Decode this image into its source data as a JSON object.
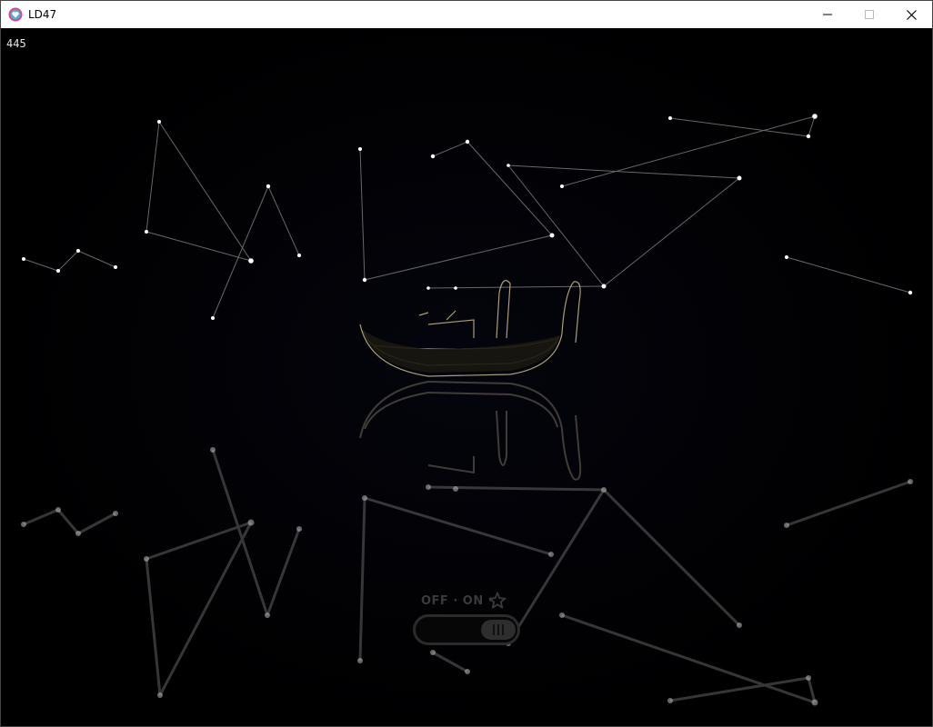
{
  "window": {
    "title": "LD47",
    "icon": "heart-app-icon",
    "controls": [
      "minimize-icon",
      "maximize-icon",
      "close-icon"
    ]
  },
  "hud": {
    "counter": "445"
  },
  "toggle": {
    "label": "OFF · ON ·",
    "icon": "star-icon",
    "state": "on"
  },
  "colors": {
    "background": "#000000",
    "star": "#ffffff",
    "boat_outline": "#c8b98a"
  }
}
